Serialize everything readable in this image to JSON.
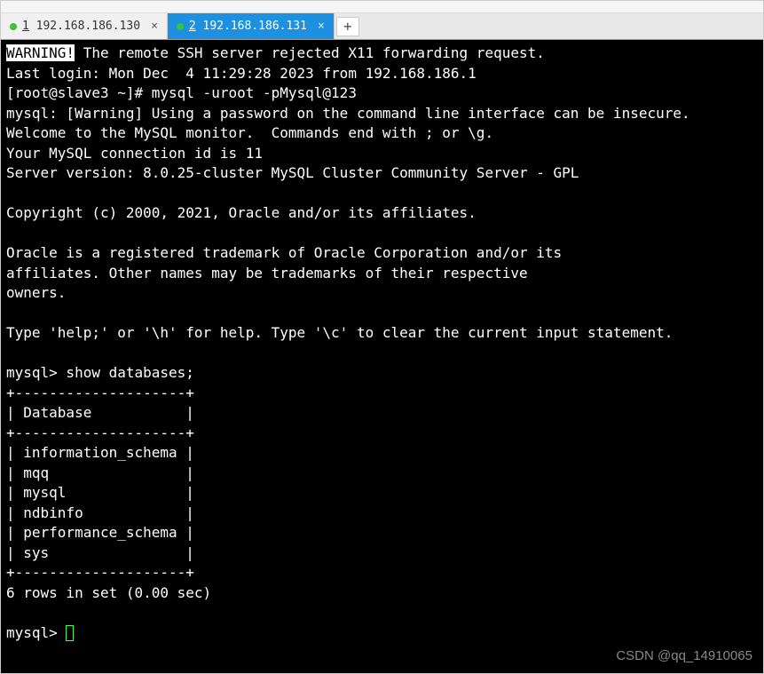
{
  "tabs": [
    {
      "number": "1",
      "ip": "192.168.186.130",
      "active": false
    },
    {
      "number": "2",
      "ip": "192.168.186.131",
      "active": true
    }
  ],
  "terminal": {
    "warning_label": "WARNING!",
    "warning_text": " The remote SSH server rejected X11 forwarding request.",
    "last_login": "Last login: Mon Dec  4 11:29:28 2023 from 192.168.186.1",
    "prompt_line": "[root@slave3 ~]# mysql -uroot -pMysql@123",
    "mysql_warning": "mysql: [Warning] Using a password on the command line interface can be insecure.",
    "welcome": "Welcome to the MySQL monitor.  Commands end with ; or \\g.",
    "connection_id": "Your MySQL connection id is 11",
    "server_version": "Server version: 8.0.25-cluster MySQL Cluster Community Server - GPL",
    "copyright": "Copyright (c) 2000, 2021, Oracle and/or its affiliates.",
    "trademark1": "Oracle is a registered trademark of Oracle Corporation and/or its",
    "trademark2": "affiliates. Other names may be trademarks of their respective",
    "trademark3": "owners.",
    "help_line": "Type 'help;' or '\\h' for help. Type '\\c' to clear the current input statement.",
    "query_prompt": "mysql> show databases;",
    "table_border": "+--------------------+",
    "table_header": "| Database           |",
    "databases": [
      "| information_schema |",
      "| mqq                |",
      "| mysql              |",
      "| ndbinfo            |",
      "| performance_schema |",
      "| sys                |"
    ],
    "result_summary": "6 rows in set (0.00 sec)",
    "final_prompt": "mysql> "
  },
  "watermark": "CSDN @qq_14910065"
}
